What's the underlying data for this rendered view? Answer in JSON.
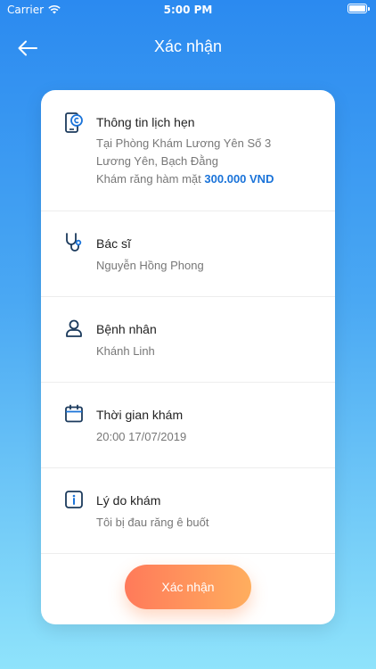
{
  "status_bar": {
    "carrier": "Carrier",
    "time": "5:00 PM"
  },
  "nav": {
    "title": "Xác nhận"
  },
  "appointment": {
    "heading": "Thông tin lịch hẹn",
    "location_line1": "Tại  Phòng Khám Lương Yên Số 3",
    "location_line2": "Lương Yên, Bạch Đằng",
    "service": "Khám răng hàm mặt",
    "price": "300.000 VND"
  },
  "doctor": {
    "heading": "Bác sĩ",
    "name": "Nguyễn Hồng Phong"
  },
  "patient": {
    "heading": "Bệnh nhân",
    "name": "Khánh Linh"
  },
  "time": {
    "heading": "Thời gian khám",
    "value": "20:00 17/07/2019"
  },
  "reason": {
    "heading": "Lý do khám",
    "value": "Tôi bị đau răng ê buốt"
  },
  "confirm_button": {
    "label": "Xác nhận"
  },
  "colors": {
    "accent": "#1a73d9",
    "button_start": "#ff7a5a",
    "button_end": "#ffae5e",
    "bg_top": "#2b8af0",
    "bg_bottom": "#8fe3fb"
  }
}
